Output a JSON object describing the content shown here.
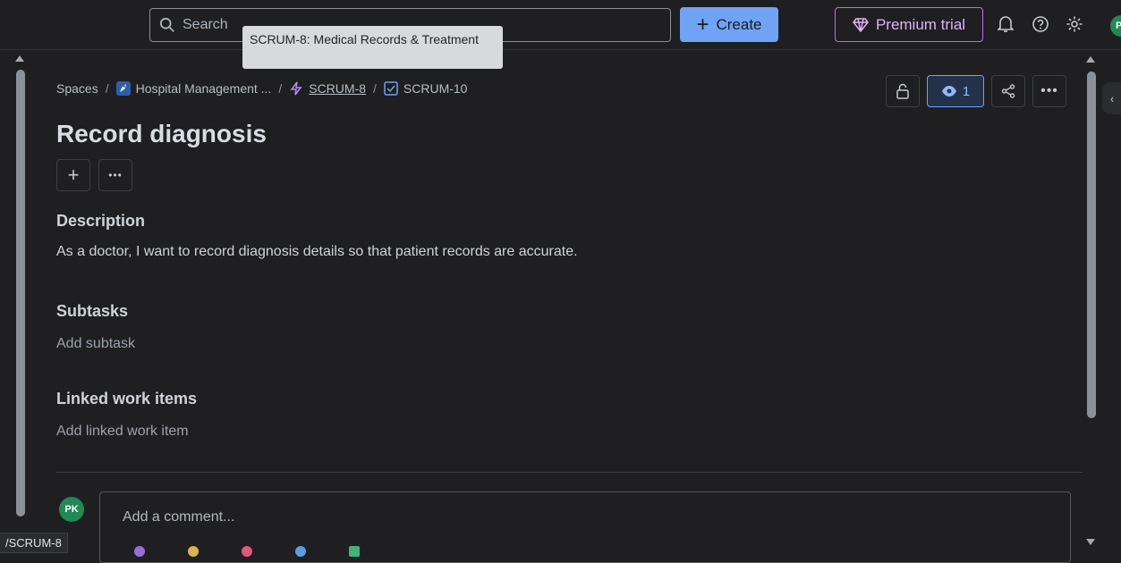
{
  "topbar": {
    "search_placeholder": "Search",
    "tooltip": "SCRUM-8: Medical Records & Treatment",
    "create_label": "Create",
    "premium_label": "Premium trial",
    "avatar_initial": "P"
  },
  "breadcrumb": {
    "root": "Spaces",
    "project": "Hospital Management ...",
    "parent": "SCRUM-8",
    "current": "SCRUM-10"
  },
  "actions": {
    "watch_count": "1"
  },
  "issue": {
    "title": "Record diagnosis",
    "description_heading": "Description",
    "description": "As a doctor, I want to record diagnosis details so that patient records are accurate.",
    "subtasks_heading": "Subtasks",
    "subtasks_placeholder": "Add subtask",
    "linked_heading": "Linked work items",
    "linked_placeholder": "Add linked work item"
  },
  "comment": {
    "avatar_initials": "PK",
    "placeholder": "Add a comment..."
  },
  "status_url": "/SCRUM-8",
  "colors": {
    "accent": "#6fa3f4",
    "premium": "#c06cf0",
    "avatar": "#1f8a55"
  }
}
